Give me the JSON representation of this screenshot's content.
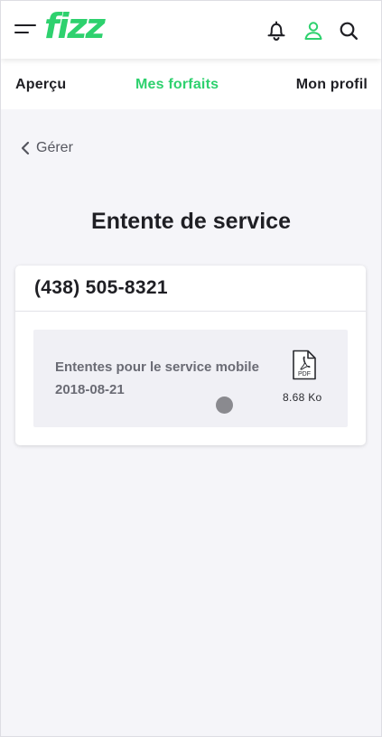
{
  "header": {
    "logo": "fizz",
    "menu_icon": "menu-icon",
    "icons": [
      "bell-icon",
      "user-icon",
      "search-icon"
    ],
    "brand_color": "#2ed16e"
  },
  "nav": {
    "items": [
      {
        "label": "Aperçu",
        "active": false
      },
      {
        "label": "Mes forfaits",
        "active": true
      },
      {
        "label": "Mon profil",
        "active": false
      }
    ]
  },
  "back": {
    "label": "Gérer",
    "icon": "chevron-left-icon"
  },
  "page": {
    "title": "Entente de service"
  },
  "card": {
    "phone": "(438) 505-8321",
    "document": {
      "title": "Ententes pour le service mobile",
      "date": "2018-08-21",
      "icon": "pdf-icon",
      "icon_label": "PDF",
      "size": "8.68 Ko"
    }
  }
}
